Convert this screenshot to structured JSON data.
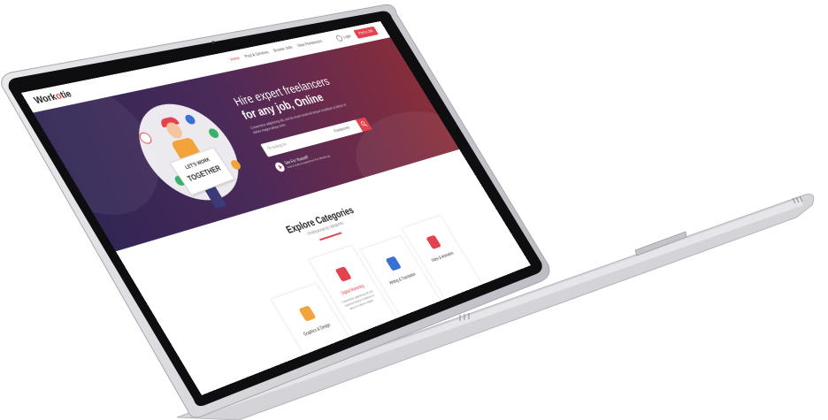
{
  "page": {
    "logo_prefix": "Work",
    "logo_accent": "o",
    "logo_suffix": "tie",
    "nav": [
      "Home",
      "Post A Services",
      "Browse Jobs",
      "View Freelancers"
    ],
    "login_label": "Login",
    "post_button": "Post a Job"
  },
  "hero": {
    "title_line1": "Hire expert freelancers",
    "title_line2": "for any job, Online",
    "text": "Consectetur adipisicing elit, sed do eiusm eiusmod tempor incididunt ut labore et dolore magna aliqua enim.",
    "search_placeholder": "I'm looking for",
    "search_category": "Freelancers",
    "video_title": "See For Yourself!",
    "video_sub": "How it works & experience the ultimate joy.",
    "sign_line1": "LET'S WORK",
    "sign_line2": "TOGETHER"
  },
  "categories": {
    "title": "Explore Categories",
    "subtitle": "Professional by categories",
    "items": [
      {
        "label": "Graphics & Design",
        "desc": "",
        "icon": "pen-tool-icon",
        "color": "#f2a33a"
      },
      {
        "label": "Digital Marketing",
        "desc": "Consectetur adipisicing elit sed eiusmod tempor incididunt ut labore et dolore magna.",
        "icon": "megaphone-icon",
        "color": "#e3424f"
      },
      {
        "label": "Writing & Translation",
        "desc": "",
        "icon": "document-icon",
        "color": "#3b6fd8"
      },
      {
        "label": "Video & Animation",
        "desc": "",
        "icon": "video-camera-icon",
        "color": "#e3424f"
      }
    ]
  },
  "colors": {
    "accent": "#e3424f",
    "hero_start": "#2f2554",
    "hero_end": "#8a2e3a",
    "laptop_body": "#d8d8dc",
    "bezel": "#0e0e10"
  }
}
